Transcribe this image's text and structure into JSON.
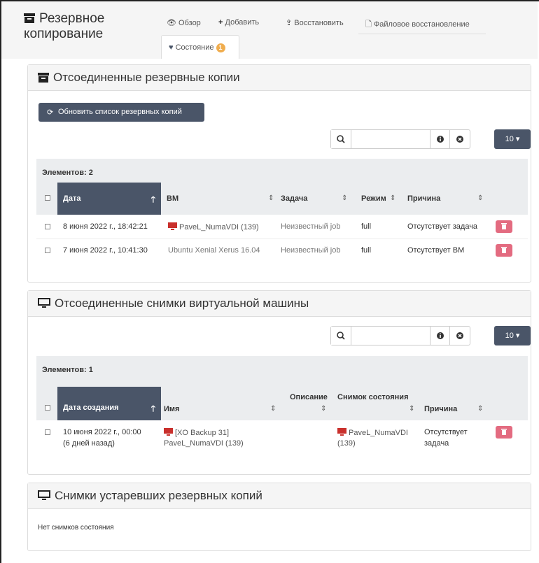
{
  "header": {
    "title_line1": "Резервное",
    "title_line2": "копирование",
    "nav": [
      {
        "label": "Обзор",
        "icon": "eye-icon"
      },
      {
        "label": "Добавить",
        "icon": "plus-icon"
      },
      {
        "label": "Восстановить",
        "icon": "upload-icon"
      },
      {
        "label": "Файловое восстановление",
        "icon": "file-icon"
      }
    ],
    "active_tab": {
      "label": "Состояние",
      "icon": "heartbeat-icon",
      "badge": "1"
    }
  },
  "detached_backups": {
    "title": "Отсоединенные резервные копии",
    "refresh_label": "Обновить список резервных копий",
    "search_value": "",
    "page_size": "10",
    "count_label": "Элементов: 2",
    "columns": [
      "Дата",
      "ВМ",
      "Задача",
      "Режим",
      "Причина"
    ],
    "rows": [
      {
        "date": "8 июня 2022 г., 18:42:21",
        "vm": "PaveL_NumaVDI (139)",
        "vm_icon": true,
        "job": "Неизвестный job",
        "mode": "full",
        "reason": "Отсутствует задача"
      },
      {
        "date": "7 июня 2022 г., 10:41:30",
        "vm": "Ubuntu Xenial Xerus 16.04",
        "vm_icon": false,
        "job": "Неизвестный job",
        "mode": "full",
        "reason": "Отсутствует ВМ"
      }
    ]
  },
  "detached_snapshots": {
    "title": "Отсоединенные снимки виртуальной машины",
    "search_value": "",
    "page_size": "10",
    "count_label": "Элементов: 1",
    "columns": [
      "Дата создания",
      "Имя",
      "Описание",
      "Снимок состояния",
      "Причина"
    ],
    "rows": [
      {
        "date_line1": "10 июня 2022 г., 00:00",
        "date_line2": "(6 дней назад)",
        "name_line1": "[XO Backup 31]",
        "name_line2": "PaveL_NumaVDI (139)",
        "snapshot_line1": "PaveL_NumaVDI",
        "snapshot_line2": "(139)",
        "reason_line1": "Отсутствует",
        "reason_line2": "задача"
      }
    ]
  },
  "legacy_snapshots": {
    "title": "Снимки устаревших резервных копий",
    "empty_text": "Нет снимков состояния"
  },
  "colors": {
    "accent_dark": "#4a5568",
    "danger": "#e36b80",
    "warning": "#f0ad4e",
    "vm_red": "#c9302c"
  }
}
